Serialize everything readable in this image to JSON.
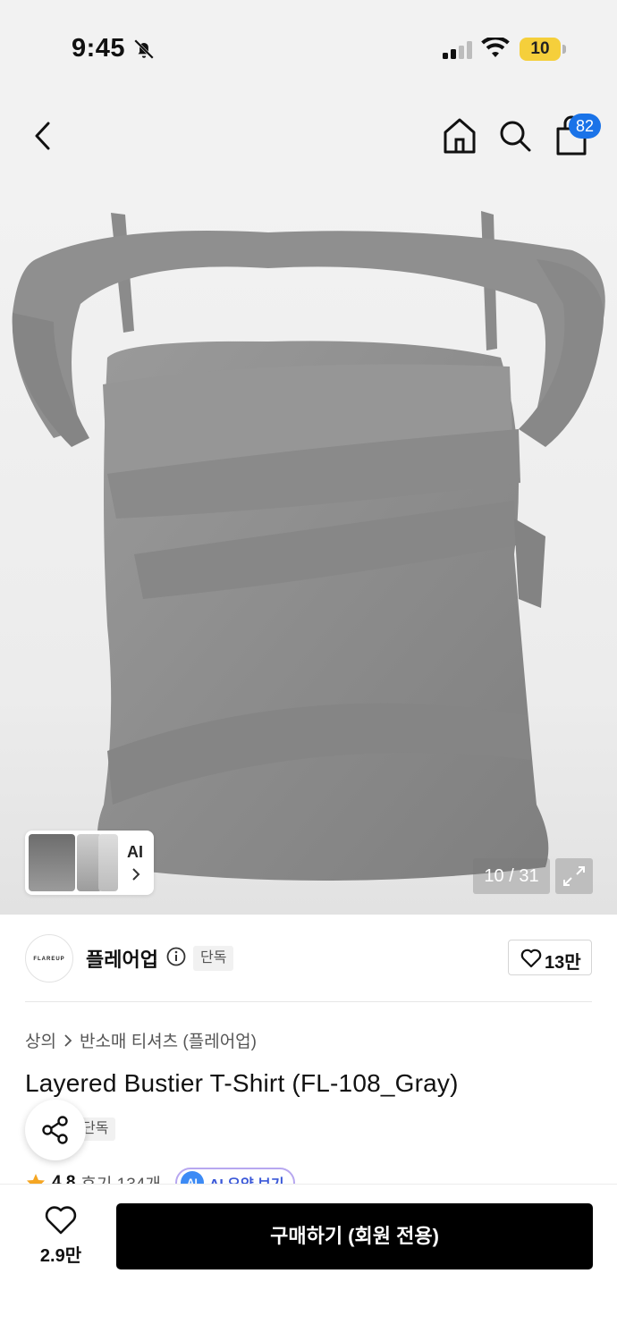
{
  "status_bar": {
    "time": "9:45",
    "battery": "10"
  },
  "header": {
    "cart_count": "82"
  },
  "image": {
    "page_indicator": "10 / 31",
    "ai_label": "AI"
  },
  "brand": {
    "logo_text": "FLAREUP",
    "name": "플레어업",
    "badge": "단독",
    "likes": "13만"
  },
  "breadcrumb": {
    "category": "상의",
    "subcategory": "반소매 티셔츠 (플레어업)"
  },
  "product": {
    "title": "Layered Bustier T-Shirt (FL-108_Gray)",
    "badge": "단독",
    "rating": "4.8",
    "reviews": "후기 134개",
    "ai_summary": "AI 요약 보기",
    "ai_badge": "AI"
  },
  "bottom_bar": {
    "wish_count": "2.9만",
    "buy_label": "구매하기 (회원 전용)"
  },
  "colors": {
    "badge_blue": "#1a73e8",
    "buy_button": "#000000",
    "star": "#f5a623",
    "ai_pill_border": "#b7a7f0"
  },
  "icons": [
    "bell-off-icon",
    "signal-icon",
    "wifi-icon",
    "battery-icon",
    "back-icon",
    "home-icon",
    "search-icon",
    "cart-icon",
    "chevron-right-icon",
    "expand-icon",
    "info-icon",
    "heart-icon",
    "share-icon",
    "star-icon"
  ]
}
